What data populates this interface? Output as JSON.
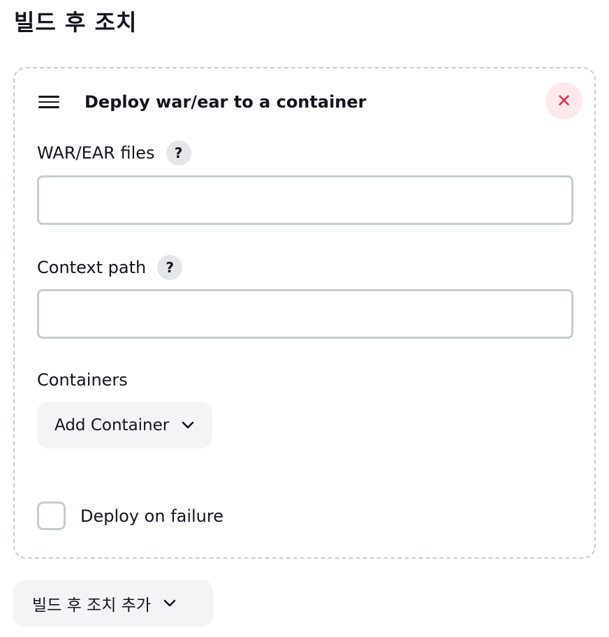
{
  "section": {
    "title": "빌드 후 조치"
  },
  "card": {
    "title": "Deploy war/ear to a container",
    "drag_icon": "hamburger-icon",
    "close_icon": "close-icon",
    "close_glyph": "✕"
  },
  "fields": {
    "war_files": {
      "label": "WAR/EAR files",
      "help": "?",
      "value": ""
    },
    "context_path": {
      "label": "Context path",
      "help": "?",
      "value": ""
    },
    "containers": {
      "label": "Containers",
      "add_button": "Add Container"
    }
  },
  "deploy_on_failure": {
    "label": "Deploy on failure",
    "checked": false
  },
  "footer": {
    "add_action_button": "빌드 후 조치 추가"
  },
  "colors": {
    "close_bg": "#fde8ec",
    "close_fg": "#e0314f",
    "border": "#c3ccd2",
    "button_bg": "#f4f4f7"
  }
}
